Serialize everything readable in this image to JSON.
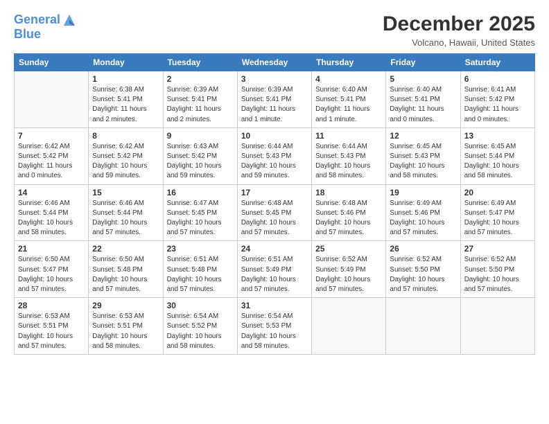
{
  "logo": {
    "line1": "General",
    "line2": "Blue"
  },
  "header": {
    "month_year": "December 2025",
    "location": "Volcano, Hawaii, United States"
  },
  "days_of_week": [
    "Sunday",
    "Monday",
    "Tuesday",
    "Wednesday",
    "Thursday",
    "Friday",
    "Saturday"
  ],
  "weeks": [
    [
      {
        "day": "",
        "info": ""
      },
      {
        "day": "1",
        "info": "Sunrise: 6:38 AM\nSunset: 5:41 PM\nDaylight: 11 hours\nand 2 minutes."
      },
      {
        "day": "2",
        "info": "Sunrise: 6:39 AM\nSunset: 5:41 PM\nDaylight: 11 hours\nand 2 minutes."
      },
      {
        "day": "3",
        "info": "Sunrise: 6:39 AM\nSunset: 5:41 PM\nDaylight: 11 hours\nand 1 minute."
      },
      {
        "day": "4",
        "info": "Sunrise: 6:40 AM\nSunset: 5:41 PM\nDaylight: 11 hours\nand 1 minute."
      },
      {
        "day": "5",
        "info": "Sunrise: 6:40 AM\nSunset: 5:41 PM\nDaylight: 11 hours\nand 0 minutes."
      },
      {
        "day": "6",
        "info": "Sunrise: 6:41 AM\nSunset: 5:42 PM\nDaylight: 11 hours\nand 0 minutes."
      }
    ],
    [
      {
        "day": "7",
        "info": "Sunrise: 6:42 AM\nSunset: 5:42 PM\nDaylight: 11 hours\nand 0 minutes."
      },
      {
        "day": "8",
        "info": "Sunrise: 6:42 AM\nSunset: 5:42 PM\nDaylight: 10 hours\nand 59 minutes."
      },
      {
        "day": "9",
        "info": "Sunrise: 6:43 AM\nSunset: 5:42 PM\nDaylight: 10 hours\nand 59 minutes."
      },
      {
        "day": "10",
        "info": "Sunrise: 6:44 AM\nSunset: 5:43 PM\nDaylight: 10 hours\nand 59 minutes."
      },
      {
        "day": "11",
        "info": "Sunrise: 6:44 AM\nSunset: 5:43 PM\nDaylight: 10 hours\nand 58 minutes."
      },
      {
        "day": "12",
        "info": "Sunrise: 6:45 AM\nSunset: 5:43 PM\nDaylight: 10 hours\nand 58 minutes."
      },
      {
        "day": "13",
        "info": "Sunrise: 6:45 AM\nSunset: 5:44 PM\nDaylight: 10 hours\nand 58 minutes."
      }
    ],
    [
      {
        "day": "14",
        "info": "Sunrise: 6:46 AM\nSunset: 5:44 PM\nDaylight: 10 hours\nand 58 minutes."
      },
      {
        "day": "15",
        "info": "Sunrise: 6:46 AM\nSunset: 5:44 PM\nDaylight: 10 hours\nand 57 minutes."
      },
      {
        "day": "16",
        "info": "Sunrise: 6:47 AM\nSunset: 5:45 PM\nDaylight: 10 hours\nand 57 minutes."
      },
      {
        "day": "17",
        "info": "Sunrise: 6:48 AM\nSunset: 5:45 PM\nDaylight: 10 hours\nand 57 minutes."
      },
      {
        "day": "18",
        "info": "Sunrise: 6:48 AM\nSunset: 5:46 PM\nDaylight: 10 hours\nand 57 minutes."
      },
      {
        "day": "19",
        "info": "Sunrise: 6:49 AM\nSunset: 5:46 PM\nDaylight: 10 hours\nand 57 minutes."
      },
      {
        "day": "20",
        "info": "Sunrise: 6:49 AM\nSunset: 5:47 PM\nDaylight: 10 hours\nand 57 minutes."
      }
    ],
    [
      {
        "day": "21",
        "info": "Sunrise: 6:50 AM\nSunset: 5:47 PM\nDaylight: 10 hours\nand 57 minutes."
      },
      {
        "day": "22",
        "info": "Sunrise: 6:50 AM\nSunset: 5:48 PM\nDaylight: 10 hours\nand 57 minutes."
      },
      {
        "day": "23",
        "info": "Sunrise: 6:51 AM\nSunset: 5:48 PM\nDaylight: 10 hours\nand 57 minutes."
      },
      {
        "day": "24",
        "info": "Sunrise: 6:51 AM\nSunset: 5:49 PM\nDaylight: 10 hours\nand 57 minutes."
      },
      {
        "day": "25",
        "info": "Sunrise: 6:52 AM\nSunset: 5:49 PM\nDaylight: 10 hours\nand 57 minutes."
      },
      {
        "day": "26",
        "info": "Sunrise: 6:52 AM\nSunset: 5:50 PM\nDaylight: 10 hours\nand 57 minutes."
      },
      {
        "day": "27",
        "info": "Sunrise: 6:52 AM\nSunset: 5:50 PM\nDaylight: 10 hours\nand 57 minutes."
      }
    ],
    [
      {
        "day": "28",
        "info": "Sunrise: 6:53 AM\nSunset: 5:51 PM\nDaylight: 10 hours\nand 57 minutes."
      },
      {
        "day": "29",
        "info": "Sunrise: 6:53 AM\nSunset: 5:51 PM\nDaylight: 10 hours\nand 58 minutes."
      },
      {
        "day": "30",
        "info": "Sunrise: 6:54 AM\nSunset: 5:52 PM\nDaylight: 10 hours\nand 58 minutes."
      },
      {
        "day": "31",
        "info": "Sunrise: 6:54 AM\nSunset: 5:53 PM\nDaylight: 10 hours\nand 58 minutes."
      },
      {
        "day": "",
        "info": ""
      },
      {
        "day": "",
        "info": ""
      },
      {
        "day": "",
        "info": ""
      }
    ]
  ]
}
